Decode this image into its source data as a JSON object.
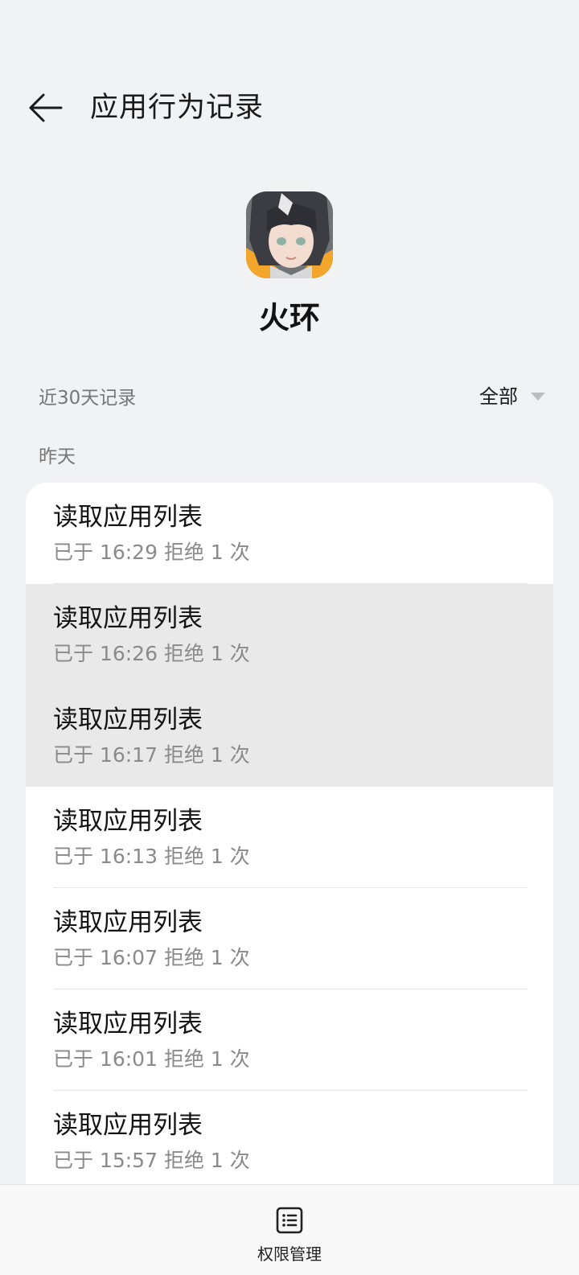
{
  "header": {
    "back_icon": "arrow-left-icon",
    "title": "应用行为记录"
  },
  "app": {
    "name": "火环",
    "icon": "app-avatar-icon"
  },
  "filter_row": {
    "range_label": "近30天记录",
    "filter_value": "全部",
    "filter_icon": "triangle-down-icon"
  },
  "section": {
    "day_label": "昨天"
  },
  "records": [
    {
      "title": "读取应用列表",
      "detail": "已于 16:29 拒绝 1 次",
      "pressed": false
    },
    {
      "title": "读取应用列表",
      "detail": "已于 16:26 拒绝 1 次",
      "pressed": true
    },
    {
      "title": "读取应用列表",
      "detail": "已于 16:17 拒绝 1 次",
      "pressed": true
    },
    {
      "title": "读取应用列表",
      "detail": "已于 16:13 拒绝 1 次",
      "pressed": false
    },
    {
      "title": "读取应用列表",
      "detail": "已于 16:07 拒绝 1 次",
      "pressed": false
    },
    {
      "title": "读取应用列表",
      "detail": "已于 16:01 拒绝 1 次",
      "pressed": false
    },
    {
      "title": "读取应用列表",
      "detail": "已于 15:57 拒绝 1 次",
      "pressed": false
    }
  ],
  "bottom_nav": {
    "label": "权限管理",
    "icon": "permission-list-icon"
  },
  "colors": {
    "background": "#f1f2f4",
    "card": "#ffffff",
    "pressed_row": "#e9e9e9",
    "secondary_text": "#8a8a8a"
  }
}
